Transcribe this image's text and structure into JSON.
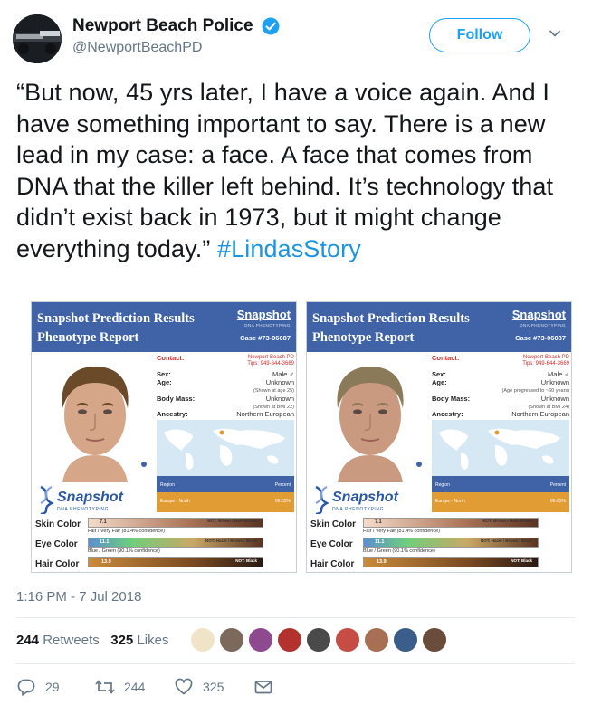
{
  "header": {
    "display_name": "Newport Beach Police",
    "handle": "@NewportBeachPD",
    "follow_label": "Follow",
    "verified_icon": "verified-badge-icon",
    "menu_icon": "chevron-down-icon"
  },
  "tweet": {
    "text": "“But now, 45 yrs later, I have a voice again. And I have something important to say. There is a new lead in my case: a face. A face that comes from DNA that the killer left behind. It’s technology that didn’t exist back in 1973, but it might change everything today.” ",
    "hashtag": "#LindasStory"
  },
  "cards": [
    {
      "title_line1": "Snapshot Prediction Results",
      "title_line2": "Phenotype Report",
      "logo": "Snapshot",
      "logo_sub": "DNA PHENOTYPING",
      "case": "Case #73-06087",
      "contact_label": "Contact:",
      "contact_value_1": "Newport Beach PD",
      "contact_value_2": "Tips: 949-644-3669",
      "sex_label": "Sex:",
      "sex_value": "Male ♂",
      "age_label": "Age:",
      "age_value": "Unknown",
      "age_note": "(Shown at age 25)",
      "mass_label": "Body Mass:",
      "mass_value": "Unknown",
      "mass_note": "(Shown at BMI 22)",
      "ancestry_label": "Ancestry:",
      "ancestry_value": "Northern European",
      "table_region": "Region",
      "table_percent": "Percent",
      "row_region": "Europe - North",
      "row_percent": "96.03%",
      "skin_label": "Skin Color",
      "skin_value": "7.1",
      "skin_not": "NOT: Brown / Dark Brown",
      "skin_conf": "Fair / Very Fair (81.4% confidence)",
      "eye_label": "Eye Color",
      "eye_value": "11.1",
      "eye_not": "NOT: Hazel / Brown / Black",
      "eye_conf": "Blue / Green (90.1% confidence)",
      "hair_label": "Hair Color",
      "hair_value": "13.9",
      "hair_not": "NOT: Black"
    },
    {
      "title_line1": "Snapshot Prediction Results",
      "title_line2": "Phenotype Report",
      "logo": "Snapshot",
      "logo_sub": "DNA PHENOTYPING",
      "case": "Case #73-06087",
      "contact_label": "Contact:",
      "contact_value_1": "Newport Beach PD",
      "contact_value_2": "Tips: 949-644-3669",
      "sex_label": "Sex:",
      "sex_value": "Male ♂",
      "age_label": "Age:",
      "age_value": "Unknown",
      "age_note": "(Age progressed to ~60 years)",
      "mass_label": "Body Mass:",
      "mass_value": "Unknown",
      "mass_note": "(Shown at BMI 24)",
      "ancestry_label": "Ancestry:",
      "ancestry_value": "Northern European",
      "table_region": "Region",
      "table_percent": "Percent",
      "row_region": "Europe - North",
      "row_percent": "96.03%",
      "skin_label": "Skin Color",
      "skin_value": "7.1",
      "skin_not": "NOT: Brown / Dark Brown",
      "skin_conf": "Fair / Very Fair (81.4% confidence)",
      "eye_label": "Eye Color",
      "eye_value": "11.1",
      "eye_not": "NOT: Hazel / Brown / Black",
      "eye_conf": "Blue / Green (90.1% confidence)",
      "hair_label": "Hair Color",
      "hair_value": "13.9",
      "hair_not": "NOT: Black"
    }
  ],
  "meta": {
    "timestamp": "1:16 PM - 7 Jul 2018",
    "retweets_count": "244",
    "retweets_label": "Retweets",
    "likes_count": "325",
    "likes_label": "Likes"
  },
  "actions": {
    "reply_count": "29",
    "retweet_count": "244",
    "like_count": "325"
  },
  "colors": {
    "accent": "#1da1f2",
    "hashtag": "#1b95e0",
    "card_header": "#3f63a6",
    "card_row": "#e19c33"
  }
}
